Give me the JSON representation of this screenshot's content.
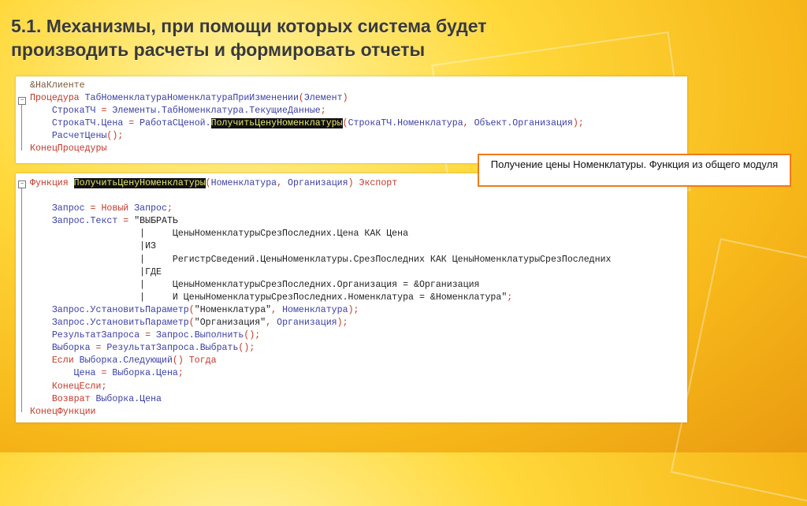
{
  "title_line1": "5.1. Механизмы, при помощи которых система будет",
  "title_line2": "производить расчеты и формировать отчеты",
  "callout": "Получение цены Номенклатуры. Функция из общего модуля",
  "code1": [
    [
      [
        "dir",
        "&НаКлиенте"
      ]
    ],
    [
      [
        "kw",
        "Процедура "
      ],
      [
        "id",
        "ТабНоменклатураНоменклатураПриИзменении"
      ],
      [
        "kw",
        "("
      ],
      [
        "id",
        "Элемент"
      ],
      [
        "kw",
        ")"
      ]
    ],
    [
      [
        "id",
        "    СтрокаТЧ "
      ],
      [
        "kw",
        "= "
      ],
      [
        "id",
        "Элементы.ТабНоменклатура.ТекущиеДанные"
      ],
      [
        "kw",
        ";"
      ]
    ],
    [
      [
        "id",
        "    СтрокаТЧ.Цена "
      ],
      [
        "kw",
        "= "
      ],
      [
        "id",
        "РаботаСЦеной."
      ],
      [
        "hl",
        "ПолучитьЦенуНоменклатуры"
      ],
      [
        "kw",
        "("
      ],
      [
        "id",
        "СтрокаТЧ.Номенклатура"
      ],
      [
        "kw",
        ", "
      ],
      [
        "id",
        "Объект.Организация"
      ],
      [
        "kw",
        ");"
      ]
    ],
    [
      [
        "id",
        "    РасчетЦены"
      ],
      [
        "kw",
        "();"
      ]
    ],
    [
      [
        "kw",
        "КонецПроцедуры"
      ]
    ]
  ],
  "code2": [
    [
      [
        "kw",
        "Функция "
      ],
      [
        "hl",
        "ПолучитьЦенуНоменклатуры"
      ],
      [
        "kw",
        "("
      ],
      [
        "id",
        "Номенклатура"
      ],
      [
        "kw",
        ", "
      ],
      [
        "id",
        "Организация"
      ],
      [
        "kw",
        ") Экспорт"
      ]
    ],
    [],
    [
      [
        "id",
        "    Запрос "
      ],
      [
        "kw",
        "= Новый "
      ],
      [
        "id",
        "Запрос"
      ],
      [
        "kw",
        ";"
      ]
    ],
    [
      [
        "id",
        "    Запрос.Текст "
      ],
      [
        "kw",
        "= "
      ],
      [
        "tx",
        "\"ВЫБРАТЬ"
      ]
    ],
    [
      [
        "tx",
        "                    |     ЦеныНоменклатурыСрезПоследних.Цена КАК Цена"
      ]
    ],
    [
      [
        "tx",
        "                    |ИЗ"
      ]
    ],
    [
      [
        "tx",
        "                    |     РегистрСведений.ЦеныНоменклатуры.СрезПоследних КАК ЦеныНоменклатурыСрезПоследних"
      ]
    ],
    [
      [
        "tx",
        "                    |ГДЕ"
      ]
    ],
    [
      [
        "tx",
        "                    |     ЦеныНоменклатурыСрезПоследних.Организация = &Организация"
      ]
    ],
    [
      [
        "tx",
        "                    |     И ЦеныНоменклатурыСрезПоследних.Номенклатура = &Номенклатура\""
      ],
      [
        "kw",
        ";"
      ]
    ],
    [
      [
        "id",
        "    Запрос.УстановитьПараметр"
      ],
      [
        "kw",
        "("
      ],
      [
        "tx",
        "\"Номенклатура\""
      ],
      [
        "kw",
        ", "
      ],
      [
        "id",
        "Номенклатура"
      ],
      [
        "kw",
        ");"
      ]
    ],
    [
      [
        "id",
        "    Запрос.УстановитьПараметр"
      ],
      [
        "kw",
        "("
      ],
      [
        "tx",
        "\"Организация\""
      ],
      [
        "kw",
        ", "
      ],
      [
        "id",
        "Организация"
      ],
      [
        "kw",
        ");"
      ]
    ],
    [
      [
        "id",
        "    РезультатЗапроса "
      ],
      [
        "kw",
        "= "
      ],
      [
        "id",
        "Запрос.Выполнить"
      ],
      [
        "kw",
        "();"
      ]
    ],
    [
      [
        "id",
        "    Выборка "
      ],
      [
        "kw",
        "= "
      ],
      [
        "id",
        "РезультатЗапроса.Выбрать"
      ],
      [
        "kw",
        "();"
      ]
    ],
    [
      [
        "kw",
        "    Если "
      ],
      [
        "id",
        "Выборка.Следующий"
      ],
      [
        "kw",
        "() Тогда"
      ]
    ],
    [
      [
        "id",
        "        Цена "
      ],
      [
        "kw",
        "= "
      ],
      [
        "id",
        "Выборка.Цена"
      ],
      [
        "kw",
        ";"
      ]
    ],
    [
      [
        "kw",
        "    КонецЕсли;"
      ]
    ],
    [
      [
        "kw",
        "    Возврат "
      ],
      [
        "id",
        "Выборка.Цена"
      ]
    ],
    [
      [
        "kw",
        "КонецФункции"
      ]
    ]
  ]
}
